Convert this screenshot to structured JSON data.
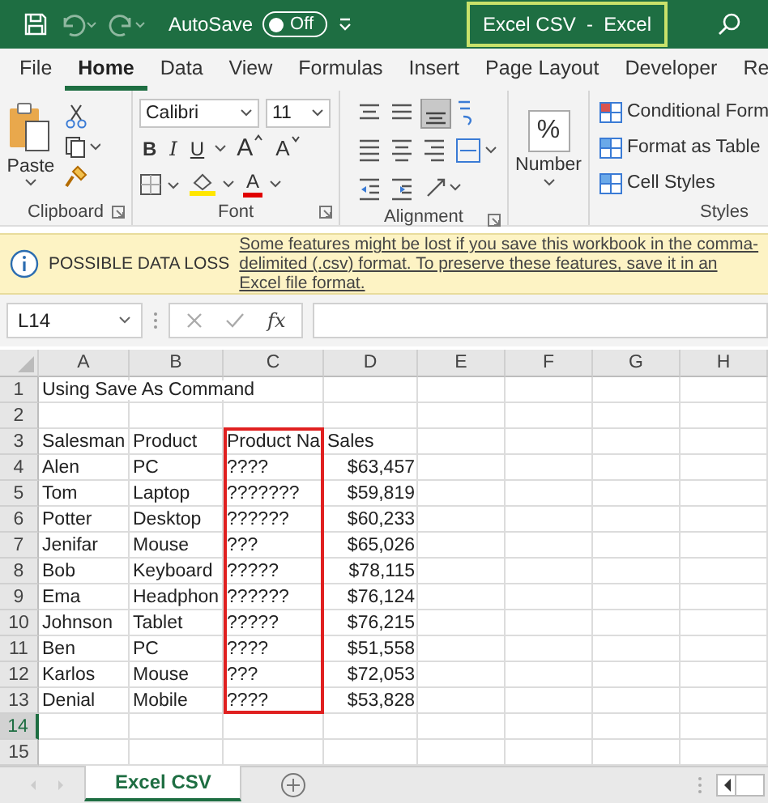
{
  "title_bar": {
    "autosave_label": "AutoSave",
    "autosave": {
      "label": "Off",
      "on": false
    },
    "title": "Excel CSV  -  Excel"
  },
  "tabs": [
    {
      "label": "File",
      "selected": false
    },
    {
      "label": "Home",
      "selected": true
    },
    {
      "label": "Data",
      "selected": false
    },
    {
      "label": "View",
      "selected": false
    },
    {
      "label": "Formulas",
      "selected": false
    },
    {
      "label": "Insert",
      "selected": false
    },
    {
      "label": "Page Layout",
      "selected": false
    },
    {
      "label": "Developer",
      "selected": false
    },
    {
      "label": "Re",
      "selected": false
    }
  ],
  "ribbon": {
    "clipboard": {
      "paste": "Paste",
      "label": "Clipboard"
    },
    "font": {
      "name": "Calibri",
      "size": "11",
      "bold": "B",
      "italic": "I",
      "underline": "U",
      "grow": "A",
      "shrink": "A",
      "font_color_letter": "A",
      "label": "Font"
    },
    "alignment": {
      "label": "Alignment"
    },
    "number": {
      "symbol": "%",
      "label": "Number"
    },
    "styles": {
      "items": [
        "Conditional Form",
        "Format as Table",
        "Cell Styles"
      ],
      "label": "Styles"
    }
  },
  "message_bar": {
    "title": "POSSIBLE DATA LOSS",
    "message": "Some features might be lost if you save this workbook in the comma-delimited (.csv) format. To preserve these features, save it in an Excel file format."
  },
  "formula_bar": {
    "name_box": "L14",
    "function_label": "fx"
  },
  "sheet": {
    "columns": [
      {
        "label": "A"
      },
      {
        "label": "B"
      },
      {
        "label": "C"
      },
      {
        "label": "D"
      },
      {
        "label": "E"
      },
      {
        "label": "F"
      },
      {
        "label": "G"
      },
      {
        "label": "H"
      }
    ],
    "rows": [
      {
        "header": "1",
        "selected": false,
        "cells": [
          {
            "text": "Using Save As Command",
            "kind": "text",
            "outlined": false
          }
        ]
      },
      {
        "header": "2",
        "selected": false
      },
      {
        "header": "3",
        "selected": false,
        "cells": [
          {
            "text": "Salesman",
            "kind": "text",
            "outlined": false
          },
          {
            "text": "Product",
            "kind": "text",
            "outlined": false
          },
          {
            "text": "Product Na",
            "kind": "text",
            "outlined": true
          },
          {
            "text": "Sales",
            "kind": "text",
            "outlined": false
          }
        ]
      },
      {
        "header": "4",
        "selected": false,
        "cells": [
          {
            "text": "Alen",
            "kind": "text",
            "outlined": false
          },
          {
            "text": "PC",
            "kind": "text",
            "outlined": false
          },
          {
            "text": "????",
            "kind": "text",
            "outlined": true
          },
          {
            "text": "$63,457",
            "kind": "number",
            "outlined": false
          }
        ]
      },
      {
        "header": "5",
        "selected": false,
        "cells": [
          {
            "text": "Tom",
            "kind": "text",
            "outlined": false
          },
          {
            "text": "Laptop",
            "kind": "text",
            "outlined": false
          },
          {
            "text": "???????",
            "kind": "text",
            "outlined": true
          },
          {
            "text": "$59,819",
            "kind": "number",
            "outlined": false
          }
        ]
      },
      {
        "header": "6",
        "selected": false,
        "cells": [
          {
            "text": "Potter",
            "kind": "text",
            "outlined": false
          },
          {
            "text": "Desktop",
            "kind": "text",
            "outlined": false
          },
          {
            "text": "??????",
            "kind": "text",
            "outlined": true
          },
          {
            "text": "$60,233",
            "kind": "number",
            "outlined": false
          }
        ]
      },
      {
        "header": "7",
        "selected": false,
        "cells": [
          {
            "text": "Jenifar",
            "kind": "text",
            "outlined": false
          },
          {
            "text": "Mouse",
            "kind": "text",
            "outlined": false
          },
          {
            "text": "???",
            "kind": "text",
            "outlined": true
          },
          {
            "text": "$65,026",
            "kind": "number",
            "outlined": false
          }
        ]
      },
      {
        "header": "8",
        "selected": false,
        "cells": [
          {
            "text": "Bob",
            "kind": "text",
            "outlined": false
          },
          {
            "text": "Keyboard",
            "kind": "text",
            "outlined": false
          },
          {
            "text": "?????",
            "kind": "text",
            "outlined": true
          },
          {
            "text": "$78,115",
            "kind": "number",
            "outlined": false
          }
        ]
      },
      {
        "header": "9",
        "selected": false,
        "cells": [
          {
            "text": "Ema",
            "kind": "text",
            "outlined": false
          },
          {
            "text": "Headphon",
            "kind": "text",
            "outlined": false
          },
          {
            "text": "??????",
            "kind": "text",
            "outlined": true
          },
          {
            "text": "$76,124",
            "kind": "number",
            "outlined": false
          }
        ]
      },
      {
        "header": "10",
        "selected": false,
        "cells": [
          {
            "text": "Johnson",
            "kind": "text",
            "outlined": false
          },
          {
            "text": "Tablet",
            "kind": "text",
            "outlined": false
          },
          {
            "text": "?????",
            "kind": "text",
            "outlined": true
          },
          {
            "text": "$76,215",
            "kind": "number",
            "outlined": false
          }
        ]
      },
      {
        "header": "11",
        "selected": false,
        "cells": [
          {
            "text": "Ben",
            "kind": "text",
            "outlined": false
          },
          {
            "text": "PC",
            "kind": "text",
            "outlined": false
          },
          {
            "text": "????",
            "kind": "text",
            "outlined": true
          },
          {
            "text": "$51,558",
            "kind": "number",
            "outlined": false
          }
        ]
      },
      {
        "header": "12",
        "selected": false,
        "cells": [
          {
            "text": "Karlos",
            "kind": "text",
            "outlined": false
          },
          {
            "text": "Mouse",
            "kind": "text",
            "outlined": false
          },
          {
            "text": "???",
            "kind": "text",
            "outlined": true
          },
          {
            "text": "$72,053",
            "kind": "number",
            "outlined": false
          }
        ]
      },
      {
        "header": "13",
        "selected": false,
        "cells": [
          {
            "text": "Denial",
            "kind": "text",
            "outlined": false
          },
          {
            "text": "Mobile",
            "kind": "text",
            "outlined": false
          },
          {
            "text": "????",
            "kind": "text",
            "outlined": true
          },
          {
            "text": "$53,828",
            "kind": "number",
            "outlined": false
          }
        ]
      },
      {
        "header": "14",
        "selected": true
      },
      {
        "header": "15",
        "selected": false
      }
    ]
  },
  "sheet_tabs": [
    {
      "label": "Excel CSV",
      "selected": true
    }
  ]
}
